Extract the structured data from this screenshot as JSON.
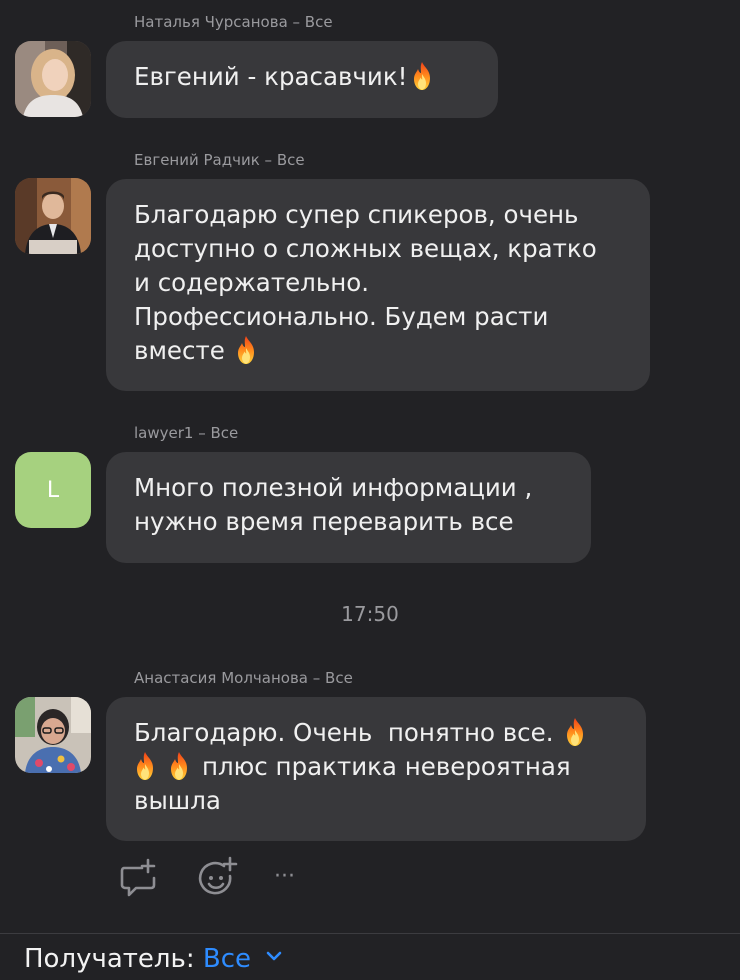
{
  "messages": [
    {
      "sender": "Наталья Чурсанова – Все",
      "avatar": "photo-avatar-woman-blonde",
      "lines": [
        "Евгений - красавчик!"
      ]
    },
    {
      "sender": "Евгений Радчик – Все",
      "avatar": "photo-avatar-man-suit",
      "lines": [
        "Благодарю супер спикеров, очень",
        "доступно о сложных вещах, кратко",
        "и содержательно.",
        "Профессионально. Будем расти",
        "вместе"
      ]
    },
    {
      "sender": "lawyer1 – Все",
      "avatar_letter": "L",
      "avatar_color": "#a6d17f",
      "lines": [
        "Много полезной информации ,",
        "нужно время переварить все"
      ]
    },
    {
      "sender": "Анастасия Молчанова – Все",
      "avatar": "photo-avatar-woman-glasses",
      "lines": [
        "Благодарю. Очень  понятно все.",
        "плюс практика невероятная",
        "вышла"
      ]
    }
  ],
  "timestamp": "17:50",
  "actions": {
    "reply_icon": "comment-add-icon",
    "reaction_icon": "emoji-add-icon",
    "more": "···"
  },
  "footer": {
    "recipient_label": "Получатель:",
    "recipient_value": "Все"
  },
  "colors": {
    "background": "#222225",
    "bubble": "#38383b",
    "accent": "#2e8cff",
    "meta_text": "#9a9a9e"
  }
}
